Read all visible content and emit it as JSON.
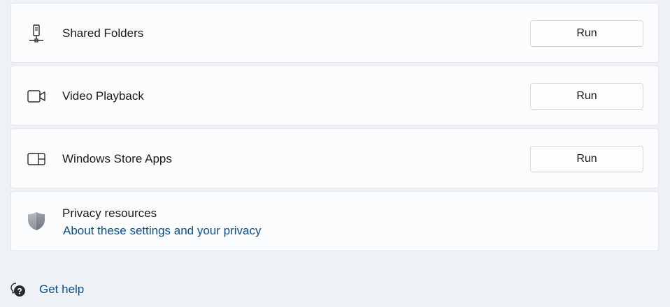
{
  "items": [
    {
      "label": "Shared Folders",
      "icon": "shared-folder-icon",
      "button_label": "Run"
    },
    {
      "label": "Video Playback",
      "icon": "video-camera-icon",
      "button_label": "Run"
    },
    {
      "label": "Windows Store Apps",
      "icon": "store-apps-icon",
      "button_label": "Run"
    }
  ],
  "privacy": {
    "title": "Privacy resources",
    "link_text": "About these settings and your privacy",
    "icon": "shield-icon"
  },
  "help": {
    "label": "Get help",
    "icon": "help-icon"
  },
  "colors": {
    "background": "#eef2f7",
    "card": "#fbfcfd",
    "link": "#0b4f8a"
  }
}
